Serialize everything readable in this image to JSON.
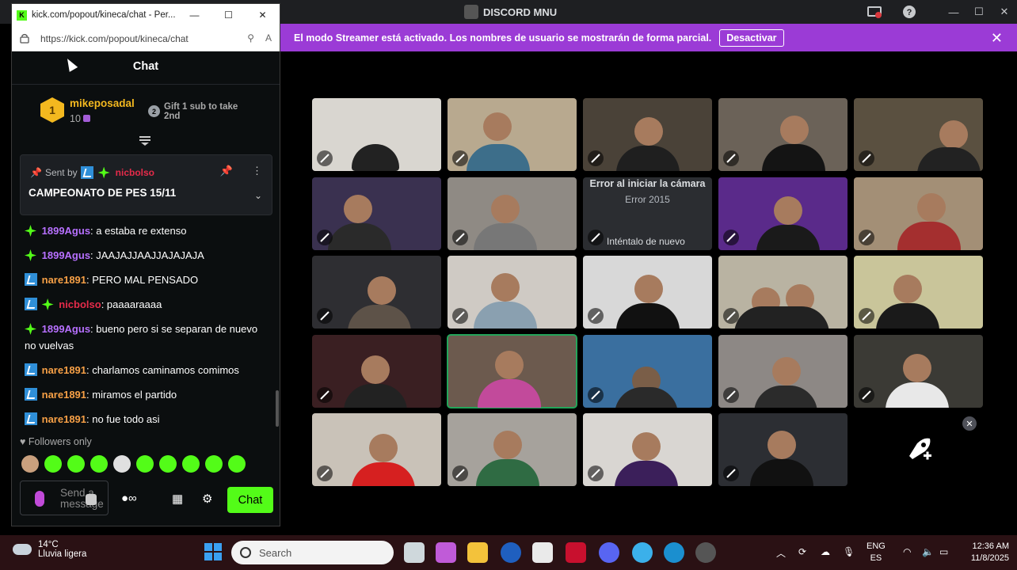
{
  "discord": {
    "title": "DISCORD MNU",
    "streamer_banner": {
      "text": "El modo Streamer está activado. Los nombres de usuario se mostrarán de forma parcial.",
      "button": "Desactivar"
    },
    "error_tile": {
      "title": "Error al iniciar la cámara",
      "code": "Error 2015",
      "retry": "Inténtalo de nuevo"
    }
  },
  "kick": {
    "window_title": "kick.com/popout/kineca/chat - Per...",
    "url": "https://kick.com/popout/kineca/chat",
    "chat_header": "Chat",
    "leaderboard": {
      "rank": "1",
      "name": "mikeposadal",
      "count": "10",
      "gift_rank": "2",
      "gift_text": "Gift 1 sub to take 2nd"
    },
    "pinned": {
      "sent_by": "Sent by",
      "user": "nicbolso",
      "title": "CAMPEONATO DE PES 15/11"
    },
    "messages": [
      {
        "user": "1899Agus",
        "text": ": a estaba re extenso"
      },
      {
        "user": "1899Agus",
        "text": ": JAAJAJJAAJJAJAJAJA"
      },
      {
        "user": "nare1891",
        "text": ": PERO MAL PENSADO"
      },
      {
        "user": "nicbolso",
        "text": ": paaaaraaaa"
      },
      {
        "user": "1899Agus",
        "text": ": bueno pero si se separan de nuevo no vuelvas"
      },
      {
        "user": "nare1891",
        "text": ": charlamos caminamos comimos"
      },
      {
        "user": "nare1891",
        "text": ": miramos el partido"
      },
      {
        "user": "nare1891",
        "text": ": no fue todo asi"
      }
    ],
    "followers_only": "Followers only",
    "input_placeholder": "Send a message",
    "chat_button": "Chat",
    "colors": {
      "accent": "#53fc18",
      "mod_badge": "#2f8fd8"
    }
  },
  "taskbar": {
    "weather_temp": "14°C",
    "weather_cond": "Lluvia ligera",
    "search_placeholder": "Search",
    "lang_top": "ENG",
    "lang_bottom": "ES",
    "time": "12:36 AM",
    "date": "11/8/2025"
  }
}
